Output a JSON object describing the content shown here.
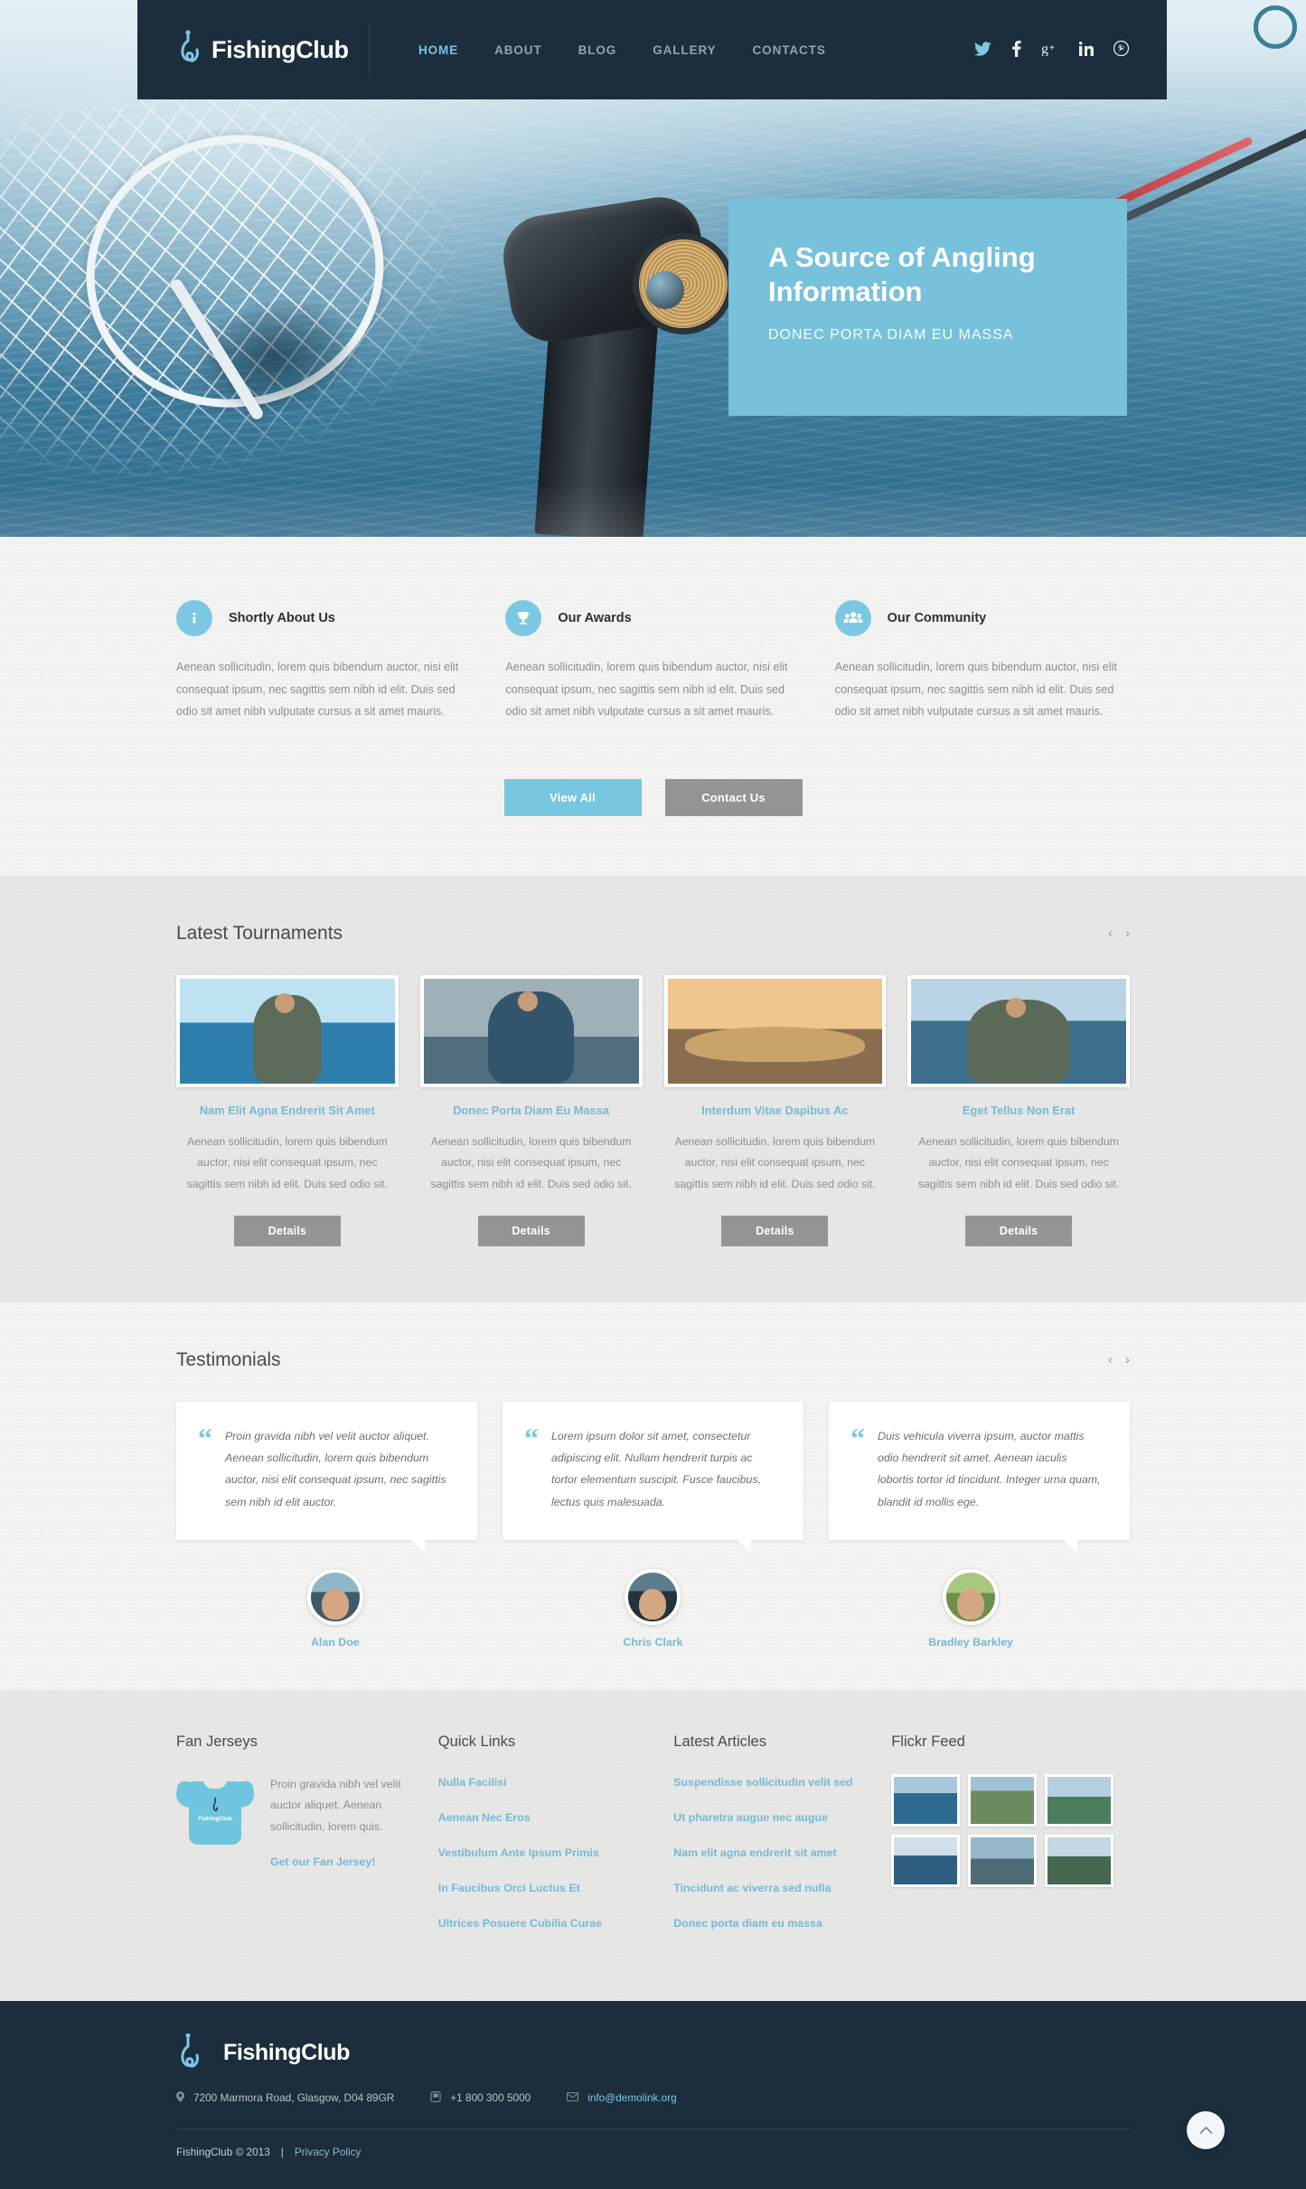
{
  "header": {
    "brand": "FishingClub",
    "logo_icon": "fish-hook-icon",
    "nav": [
      {
        "label": "HOME",
        "active": true
      },
      {
        "label": "ABOUT",
        "active": false
      },
      {
        "label": "BLOG",
        "active": false
      },
      {
        "label": "GALLERY",
        "active": false
      },
      {
        "label": "CONTACTS",
        "active": false
      }
    ],
    "social": [
      {
        "name": "twitter-icon",
        "glyph": "🐦",
        "color": "#7cc8e3"
      },
      {
        "name": "facebook-icon",
        "glyph": "f",
        "color": "#e9eef1"
      },
      {
        "name": "google-plus-icon",
        "glyph": "g+",
        "color": "#e9eef1"
      },
      {
        "name": "linkedin-icon",
        "glyph": "in",
        "color": "#e9eef1"
      },
      {
        "name": "pinterest-icon",
        "glyph": "Ⓟ",
        "color": "#e9eef1"
      }
    ]
  },
  "hero": {
    "title": "A Source of Angling Information",
    "subtitle": "DONEC PORTA DIAM EU MASSA",
    "accent_color": "#77c2da"
  },
  "features": {
    "items": [
      {
        "icon": "info-icon",
        "glyph": "i",
        "title": "Shortly About Us",
        "text": "Aenean sollicitudin, lorem quis bibendum auctor, nisi elit consequat ipsum, nec sagittis sem nibh id elit. Duis sed odio sit amet nibh vulputate cursus a sit amet mauris."
      },
      {
        "icon": "trophy-icon",
        "glyph": "Ἴ6",
        "title": "Our Awards",
        "text": "Aenean sollicitudin, lorem quis bibendum auctor, nisi elit consequat ipsum, nec sagittis sem nibh id elit. Duis sed odio sit amet nibh vulputate cursus a sit amet mauris."
      },
      {
        "icon": "community-icon",
        "glyph": "὆5",
        "title": "Our Community",
        "text": "Aenean sollicitudin, lorem quis bibendum auctor, nisi elit consequat ipsum, nec sagittis sem nibh id elit. Duis sed odio sit amet nibh vulputate cursus a sit amet mauris."
      }
    ],
    "view_all_label": "View All",
    "contact_label": "Contact Us"
  },
  "tournaments": {
    "heading": "Latest Tournaments",
    "prev_icon": "chevron-left-icon",
    "next_icon": "chevron-right-icon",
    "prev_glyph": "‹",
    "next_glyph": "›",
    "details_label": "Details",
    "items": [
      {
        "title": "Nam Elit Agna Endrerit Sit Amet",
        "text": "Aenean sollicitudin, lorem quis bibendum auctor, nisi elit consequat ipsum, nec sagittis sem nibh id elit. Duis sed odio sit.",
        "details_label": "Details"
      },
      {
        "title": "Donec Porta Diam Eu Massa",
        "text": "Aenean sollicitudin, lorem quis bibendum auctor, nisi elit consequat ipsum, nec sagittis sem nibh id elit. Duis sed odio sit.",
        "details_label": "Details"
      },
      {
        "title": "Interdum Vitae Dapibus Ac",
        "text": "Aenean sollicitudin, lorem quis bibendum auctor, nisi elit consequat ipsum, nec sagittis sem nibh id elit. Duis sed odio sit.",
        "details_label": "Details"
      },
      {
        "title": "Eget Tellus Non Erat",
        "text": "Aenean sollicitudin, lorem quis bibendum auctor, nisi elit consequat ipsum, nec sagittis sem nibh id elit. Duis sed odio sit.",
        "details_label": "Details"
      }
    ]
  },
  "testimonials": {
    "heading": "Testimonials",
    "prev_glyph": "‹",
    "next_glyph": "›",
    "items": [
      {
        "quote": "Proin gravida nibh vel velit auctor aliquet. Aenean sollicitudin, lorem quis bibendum auctor, nisi elit consequat ipsum, nec sagittis sem nibh id elit auctor.",
        "author": "Alan Doe"
      },
      {
        "quote": "Lorem ipsum dolor sit amet, consectetur adipiscing elit. Nullam hendrerit turpis ac tortor elementum suscipit. Fusce faucibus, lectus quis malesuada.",
        "author": "Chris Clark"
      },
      {
        "quote": "Duis vehicula viverra ipsum, auctor mattis odio hendrerit sit amet. Aenean iaculis lobortis tortor id tincidunt. Integer urna quam, blandit id mollis ege.",
        "author": "Bradley Barkley"
      }
    ]
  },
  "widgets": {
    "fan_jerseys": {
      "heading": "Fan Jerseys",
      "jersey_label": "FishingClub",
      "text": "Proin gravida nibh vel velit auctor aliquet. Aenean sollicitudin, lorem quis.",
      "link": "Get our Fan Jersey!"
    },
    "quick_links": {
      "heading": "Quick Links",
      "items": [
        "Nulla Facilisi",
        "Aenean Nec Eros",
        "Vestibulum Ante Ipsum Primis",
        "In Faucibus Orci Luctus Et",
        "Ultrices Posuere Cubilia Curae"
      ]
    },
    "latest_articles": {
      "heading": "Latest Articles",
      "items": [
        "Suspendisse sollicitudin velit sed",
        "Ut pharetra augue nec augue",
        "Nam elit agna endrerit sit amet",
        "Tincidunt ac viverra sed nulla",
        "Donec porta diam eu massa"
      ]
    },
    "flickr": {
      "heading": "Flickr Feed",
      "count": 6
    }
  },
  "footer": {
    "brand": "FishingClub",
    "address": "7200  Marmora Road, Glasgow, D04 89GR",
    "address_icon": "map-pin-icon",
    "phone": "+1 800 300 5000",
    "phone_icon": "phone-icon",
    "email": "info@demolink.org",
    "email_icon": "envelope-icon",
    "copyright": "FishingClub © 2013",
    "separator": "|",
    "privacy": "Privacy Policy",
    "to_top_icon": "chevron-up-icon",
    "to_top_glyph": "⌃"
  }
}
